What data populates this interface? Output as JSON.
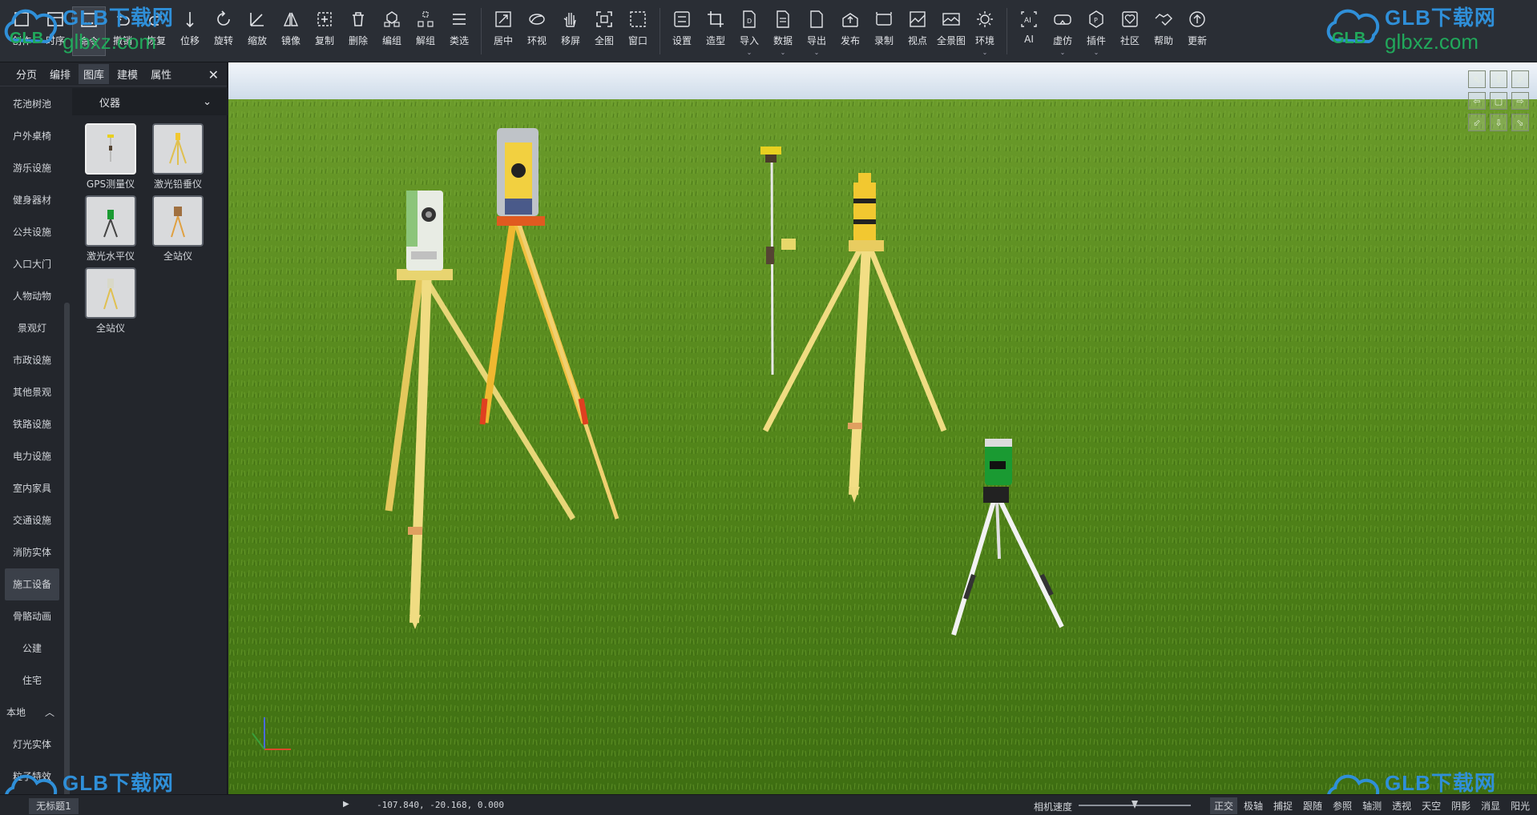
{
  "toolbar": {
    "groups": [
      [
        {
          "id": "create",
          "label": "创作",
          "icon": "square-icon"
        },
        {
          "id": "timeline",
          "label": "时序",
          "icon": "timeline-icon"
        },
        {
          "id": "command",
          "label": "命令",
          "icon": "command-icon",
          "active": true
        },
        {
          "id": "undo",
          "label": "撤销",
          "icon": "undo-icon"
        },
        {
          "id": "redo",
          "label": "恢复",
          "icon": "redo-icon"
        },
        {
          "id": "move",
          "label": "位移",
          "icon": "move-icon"
        },
        {
          "id": "rotate",
          "label": "旋转",
          "icon": "rotate-icon"
        },
        {
          "id": "scale",
          "label": "缩放",
          "icon": "scale-icon"
        },
        {
          "id": "mirror",
          "label": "镜像",
          "icon": "mirror-icon"
        },
        {
          "id": "copy",
          "label": "复制",
          "icon": "copy-icon"
        },
        {
          "id": "delete",
          "label": "删除",
          "icon": "trash-icon"
        },
        {
          "id": "group",
          "label": "编组",
          "icon": "group-icon"
        },
        {
          "id": "ungroup",
          "label": "解组",
          "icon": "ungroup-icon"
        },
        {
          "id": "select-type",
          "label": "类选",
          "icon": "list-icon"
        }
      ],
      [
        {
          "id": "center",
          "label": "居中",
          "icon": "center-icon"
        },
        {
          "id": "orbit",
          "label": "环视",
          "icon": "orbit-icon"
        },
        {
          "id": "pan",
          "label": "移屏",
          "icon": "hand-icon"
        },
        {
          "id": "fit-all",
          "label": "全图",
          "icon": "fit-icon"
        },
        {
          "id": "window",
          "label": "窗口",
          "icon": "window-icon"
        }
      ],
      [
        {
          "id": "settings",
          "label": "设置",
          "icon": "settings-icon"
        },
        {
          "id": "modeling",
          "label": "造型",
          "icon": "crop-icon"
        },
        {
          "id": "import",
          "label": "导入",
          "icon": "import-icon",
          "caret": true
        },
        {
          "id": "data",
          "label": "数据",
          "icon": "data-icon",
          "caret": true
        },
        {
          "id": "export",
          "label": "导出",
          "icon": "export-icon",
          "caret": true
        },
        {
          "id": "publish",
          "label": "发布",
          "icon": "publish-icon"
        },
        {
          "id": "record",
          "label": "录制",
          "icon": "record-icon"
        },
        {
          "id": "viewpoint",
          "label": "视点",
          "icon": "viewpoint-icon"
        },
        {
          "id": "panorama",
          "label": "全景图",
          "icon": "panorama-icon"
        },
        {
          "id": "environment",
          "label": "环境",
          "icon": "sun-icon",
          "caret": true
        }
      ],
      [
        {
          "id": "ai",
          "label": "AI",
          "icon": "ai-icon"
        },
        {
          "id": "vr",
          "label": "虚仿",
          "icon": "vr-icon",
          "caret": true
        },
        {
          "id": "plugin",
          "label": "插件",
          "icon": "plugin-icon",
          "caret": true
        },
        {
          "id": "community",
          "label": "社区",
          "icon": "heart-icon"
        },
        {
          "id": "help",
          "label": "帮助",
          "icon": "handshake-icon"
        },
        {
          "id": "update",
          "label": "更新",
          "icon": "update-icon"
        }
      ]
    ]
  },
  "watermark": {
    "brand": "GLB下载网",
    "domain": "glbxz.com",
    "cloud_text": "GLB"
  },
  "panel": {
    "tabs": [
      {
        "label": "分页"
      },
      {
        "label": "编排"
      },
      {
        "label": "图库",
        "active": true
      },
      {
        "label": "建模"
      },
      {
        "label": "属性"
      }
    ],
    "close": "✕",
    "categories": [
      {
        "label": "花池树池"
      },
      {
        "label": "户外桌椅"
      },
      {
        "label": "游乐设施"
      },
      {
        "label": "健身器材"
      },
      {
        "label": "公共设施"
      },
      {
        "label": "入口大门"
      },
      {
        "label": "人物动物"
      },
      {
        "label": "景观灯"
      },
      {
        "label": "市政设施"
      },
      {
        "label": "其他景观"
      },
      {
        "label": "铁路设施"
      },
      {
        "label": "电力设施"
      },
      {
        "label": "室内家具"
      },
      {
        "label": "交通设施"
      },
      {
        "label": "消防实体"
      },
      {
        "label": "施工设备",
        "active": true
      },
      {
        "label": "骨骼动画"
      },
      {
        "label": "公建"
      },
      {
        "label": "住宅"
      }
    ],
    "local_section": {
      "label": "本地",
      "chevron": "︿"
    },
    "local_items": [
      {
        "label": "灯光实体"
      },
      {
        "label": "粒子特效"
      }
    ],
    "dropdown": {
      "value": "仪器",
      "chevron": "⌄"
    },
    "thumbnails": [
      {
        "label": "GPS测量仪",
        "selected": true,
        "kind": "gps"
      },
      {
        "label": "激光铅垂仪",
        "kind": "plumb"
      },
      {
        "label": "激光水平仪",
        "kind": "level"
      },
      {
        "label": "全站仪",
        "kind": "station"
      },
      {
        "label": "全站仪",
        "kind": "station2"
      }
    ]
  },
  "viewport": {
    "sky_color": "#dfe9f3",
    "grass_color": "#5c8a1e",
    "nav_buttons": [
      "⬁",
      "⇧",
      "⬀",
      "⇦",
      "▢",
      "⇨",
      "⬃",
      "⇩",
      "⬂"
    ],
    "axes": {
      "x": "X",
      "y": "Y",
      "z": "Z"
    }
  },
  "statusbar": {
    "doc_tab": "无标题1",
    "play": "▶",
    "coordinates": "-107.840, -20.168, 0.000",
    "camera_speed_label": "相机速度",
    "camera_speed": 0.5,
    "modes": [
      {
        "label": "正交",
        "on": true
      },
      {
        "label": "极轴"
      },
      {
        "label": "捕捉"
      },
      {
        "label": "跟随"
      },
      {
        "label": "参照"
      },
      {
        "label": "轴测"
      },
      {
        "label": "透视"
      },
      {
        "label": "天空"
      },
      {
        "label": "阴影"
      },
      {
        "label": "消显"
      },
      {
        "label": "阳光"
      }
    ]
  }
}
